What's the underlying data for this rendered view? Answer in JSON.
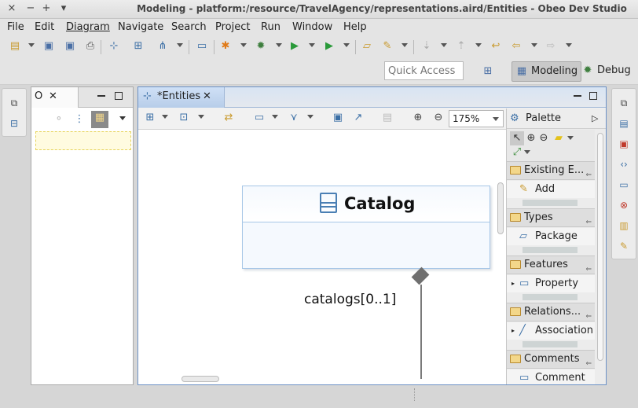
{
  "window": {
    "title": "Modeling - platform:/resource/TravelAgency/representations.aird/Entities - Obeo Dev Studio",
    "controls": [
      "×",
      "−",
      "+",
      "▾"
    ]
  },
  "menu": [
    "File",
    "Edit",
    "Diagram",
    "Navigate",
    "Search",
    "Project",
    "Run",
    "Window",
    "Help"
  ],
  "quick_access": {
    "placeholder": "Quick Access"
  },
  "perspectives": [
    {
      "label": "Modeling",
      "active": true
    },
    {
      "label": "Debug",
      "active": false
    }
  ],
  "outline_view": {
    "tab_label": "O"
  },
  "editor": {
    "tab_label": "*Entities",
    "zoom": "175%",
    "diagram": {
      "class_name": "Catalog",
      "association_role": "catalogs[0..1]"
    }
  },
  "palette": {
    "title": "Palette",
    "drawers": [
      {
        "label": "Existing E...",
        "entry": "Add"
      },
      {
        "label": "Types",
        "entry": "Package"
      },
      {
        "label": "Features",
        "entry": "Property"
      },
      {
        "label": "Relations...",
        "entry": "Association"
      },
      {
        "label": "Comments",
        "entry": "Comment"
      }
    ]
  },
  "colors": {
    "accent_blue": "#6c91c6",
    "class_border": "#a7c7e7",
    "folder_yellow": "#f3d78a"
  }
}
